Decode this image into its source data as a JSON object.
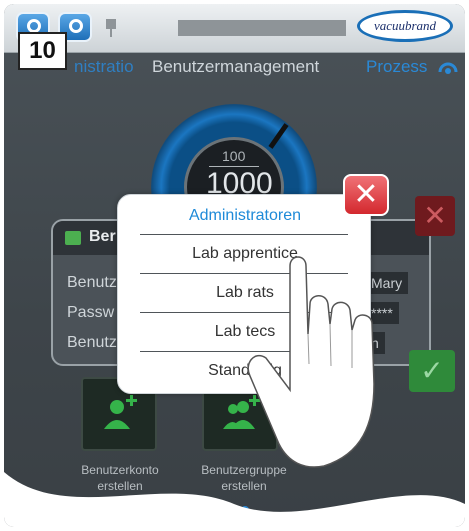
{
  "step_number": "10",
  "topbar": {
    "logo_text": "vacuubrand"
  },
  "tabs": {
    "left": "nistratio",
    "active": "Benutzermanagement",
    "right": "Prozess"
  },
  "gauge": {
    "upper_value": "100",
    "lower_value": "1000"
  },
  "user_panel": {
    "title": "Ber",
    "rows": [
      {
        "label": "Benutz",
        "value": "Mary"
      },
      {
        "label": "Passw",
        "value": "****"
      },
      {
        "label": "Benutz",
        "value": "n"
      }
    ]
  },
  "actions": {
    "create_account": "Benutzerkonto erstellen",
    "create_group": "Benutzergruppe erstellen"
  },
  "group_dropdown": {
    "options": [
      {
        "label": "Administratoren",
        "selected": true
      },
      {
        "label": "Lab apprentice",
        "selected": false
      },
      {
        "label": "Lab rats",
        "selected": false
      },
      {
        "label": "Lab tecs",
        "selected": false
      },
      {
        "label": "Standardg",
        "selected": false
      }
    ]
  },
  "colors": {
    "accent": "#1e8ad8",
    "close": "#d3282e",
    "confirm": "#2f8a3a"
  },
  "icons": {
    "close": "close-icon",
    "confirm": "checkmark-icon",
    "cancel": "cancel-icon",
    "pointer": "pointing-hand-icon"
  }
}
